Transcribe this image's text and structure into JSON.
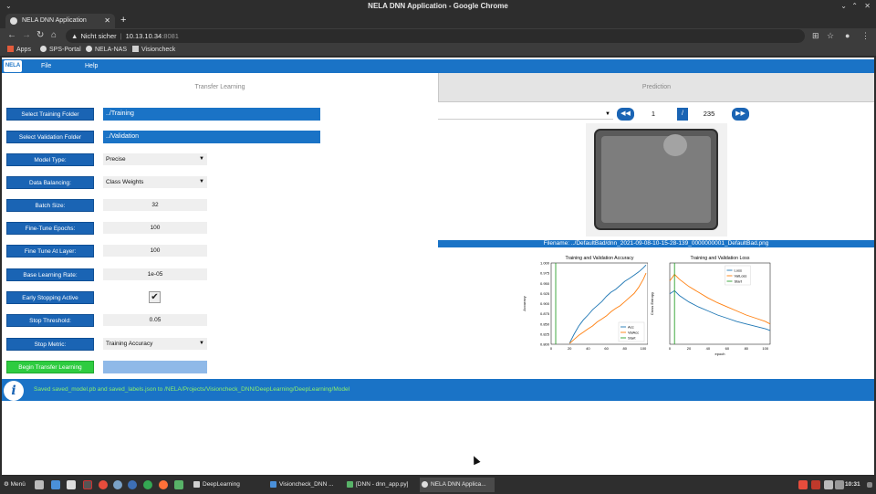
{
  "window": {
    "title": "NELA DNN Application - Google Chrome"
  },
  "browser": {
    "tab_title": "NELA DNN Application",
    "address": {
      "security": "Nicht sicher",
      "host": "10.13.10.34",
      "port": ":8081"
    },
    "bookmarks": [
      "Apps",
      "SPS-Portal",
      "NELA-NAS",
      "Visioncheck"
    ]
  },
  "app": {
    "logo": "NELA",
    "menu": [
      "File",
      "Help"
    ],
    "tabs": [
      "Transfer Learning",
      "Prediction"
    ],
    "training_folder_button": "Select Training Folder",
    "training_folder_value": "../Training",
    "validation_folder_button": "Select Validation Folder",
    "validation_folder_value": "../Validation",
    "params": [
      {
        "label": "Model Type:",
        "value": "Precise",
        "kind": "select"
      },
      {
        "label": "Data Balancing:",
        "value": "Class Weights",
        "kind": "select"
      },
      {
        "label": "Batch Size:",
        "value": "32",
        "kind": "input"
      },
      {
        "label": "Fine-Tune Epochs:",
        "value": "100",
        "kind": "input"
      },
      {
        "label": "Fine Tune At Layer:",
        "value": "100",
        "kind": "input"
      },
      {
        "label": "Base Learning Rate:",
        "value": "1e-05",
        "kind": "input"
      },
      {
        "label": "Early Stopping Active",
        "value": "✔",
        "kind": "check"
      },
      {
        "label": "Stop Threshold:",
        "value": "0.05",
        "kind": "input"
      },
      {
        "label": "Stop Metric:",
        "value": "Training Accuracy",
        "kind": "select"
      }
    ],
    "begin_button": "Begin Transfer Learning",
    "prediction": {
      "current_page": "1",
      "slash": "/",
      "total_pages": "235",
      "filename": "Filename: ../DefaultBad/dnn_2021-09-08-10-15-28-139_0000000001_DefaultBad.png"
    },
    "status_message": "Saved saved_model.pb and saved_labels.json to /NELA/Projects/Visioncheck_DNN/DeepLearning/DeepLearning/Model"
  },
  "chart_data": [
    {
      "type": "line",
      "title": "Training and Validation Accuracy",
      "ylabel": "Accuracy",
      "xlabel": "",
      "xlim": [
        0,
        105
      ],
      "ylim": [
        0.8,
        1.0
      ],
      "yticks": [
        "0.800",
        "0.825",
        "0.850",
        "0.875",
        "0.900",
        "0.925",
        "0.950",
        "0.975",
        "1.000"
      ],
      "xticks": [
        "0",
        "20",
        "40",
        "60",
        "80",
        "100"
      ],
      "legend": "bottom-right",
      "series": [
        {
          "name": "Acc",
          "color": "#1f77b4",
          "x": [
            20,
            25,
            30,
            35,
            40,
            45,
            50,
            55,
            60,
            65,
            70,
            75,
            80,
            85,
            90,
            95,
            100,
            103
          ],
          "y": [
            0.803,
            0.825,
            0.845,
            0.86,
            0.872,
            0.885,
            0.895,
            0.905,
            0.918,
            0.928,
            0.935,
            0.945,
            0.955,
            0.962,
            0.97,
            0.978,
            0.988,
            0.995
          ]
        },
        {
          "name": "ValAcc",
          "color": "#ff7f0e",
          "x": [
            20,
            25,
            30,
            35,
            40,
            45,
            50,
            55,
            60,
            65,
            70,
            75,
            80,
            85,
            90,
            95,
            100,
            103
          ],
          "y": [
            0.802,
            0.812,
            0.822,
            0.83,
            0.838,
            0.845,
            0.855,
            0.862,
            0.87,
            0.88,
            0.888,
            0.895,
            0.905,
            0.915,
            0.925,
            0.94,
            0.96,
            0.975
          ]
        },
        {
          "name": "Start",
          "color": "#2ca02c",
          "x": [
            5,
            5
          ],
          "y": [
            0.8,
            1.0
          ]
        }
      ]
    },
    {
      "type": "line",
      "title": "Training and Validation Loss",
      "ylabel": "Cross Entropy",
      "xlabel": "epoch",
      "xlim": [
        0,
        105
      ],
      "ylim": [
        0,
        1
      ],
      "xticks": [
        "0",
        "20",
        "40",
        "60",
        "80",
        "100"
      ],
      "legend": "top-right",
      "series": [
        {
          "name": "Loss",
          "color": "#1f77b4",
          "x": [
            0,
            5,
            10,
            20,
            30,
            40,
            50,
            60,
            70,
            80,
            90,
            100,
            105
          ],
          "y": [
            0.62,
            0.66,
            0.6,
            0.52,
            0.46,
            0.41,
            0.36,
            0.32,
            0.28,
            0.25,
            0.22,
            0.19,
            0.17
          ]
        },
        {
          "name": "ValLoss",
          "color": "#ff7f0e",
          "x": [
            0,
            5,
            10,
            20,
            30,
            40,
            50,
            60,
            70,
            80,
            90,
            100,
            105
          ],
          "y": [
            0.78,
            0.86,
            0.8,
            0.71,
            0.64,
            0.57,
            0.51,
            0.46,
            0.41,
            0.36,
            0.32,
            0.28,
            0.25
          ]
        },
        {
          "name": "Start",
          "color": "#2ca02c",
          "x": [
            5,
            5
          ],
          "y": [
            0,
            1
          ]
        }
      ]
    }
  ],
  "taskbar": {
    "menu": "Menü",
    "windows": [
      "DeepLearning",
      "Visioncheck_DNN ...",
      "[DNN - dnn_app.py]",
      "NELA DNN Applica..."
    ],
    "clock": "10:31"
  }
}
